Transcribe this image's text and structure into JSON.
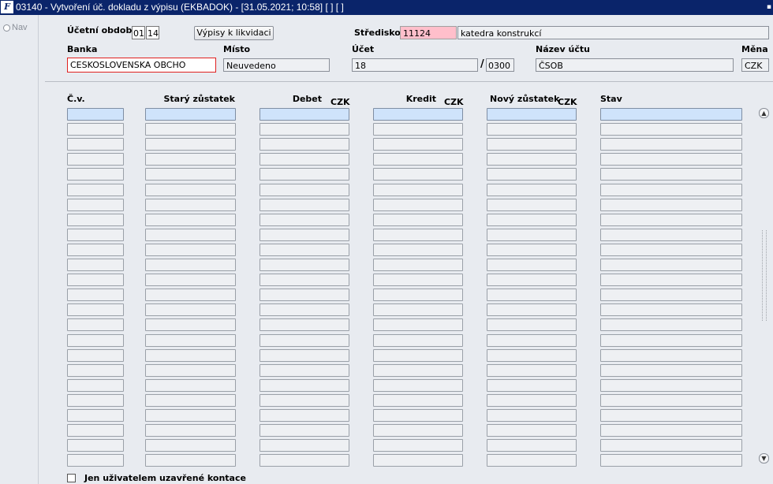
{
  "window": {
    "title": "03140 - Vytvoření úč. dokladu z výpisu (EKBADOK) - [31.05.2021; 10:58]  [ ]  [ ]",
    "app_icon_text": "F",
    "corner_glyph": "▪"
  },
  "nav": {
    "label": "Nav"
  },
  "header": {
    "period_label": "Účetní období",
    "period_month": "01",
    "period_year": "14",
    "vypisy_button": "Výpisy k likvidaci",
    "stredisko_label": "Středisko",
    "stredisko_code": "11124",
    "stredisko_name": "katedra konstrukcí",
    "banka_label": "Banka",
    "banka_value": "CESKOSLOVENSKA OBCHO",
    "misto_label": "Místo",
    "misto_value": "Neuvedeno",
    "ucet_label": "Účet",
    "ucet_value": "18",
    "slash": "/",
    "bank_code": "0300",
    "nazev_label": "Název účtu",
    "nazev_value": "ČSOB",
    "mena_label": "Měna",
    "mena_value": "CZK"
  },
  "grid": {
    "columns": {
      "cv": "Č.v.",
      "stary": "Starý zůstatek",
      "debet": "Debet",
      "kredit": "Kredit",
      "novy": "Nový zůstatek",
      "stav": "Stav"
    },
    "currency": "CZK",
    "rows_count": 24
  },
  "footer": {
    "checkbox_label": "Jen uživatelem uzavřené kontace",
    "checkbox_checked": false
  },
  "colors": {
    "titlebar": "#0a246a",
    "background": "#e8ebf0",
    "selected_row": "#cfe3fb",
    "required_field": "#ffbfcb",
    "error_border": "#e02020"
  }
}
